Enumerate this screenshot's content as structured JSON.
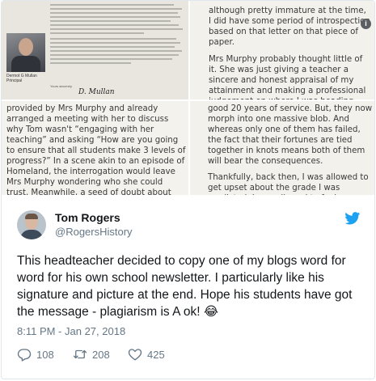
{
  "media": {
    "newsletter": {
      "caption_name": "Dermot G Mullan",
      "caption_role": "Principal",
      "sign_label": "Yours sincerely",
      "signature": "D. Mullan"
    },
    "blog_top_right": {
      "p1": "although pretty immature at the time, I did have some period of introspection based on that letter on that piece of paper.",
      "p2": "Mrs Murphy probably thought little of it. She was just giving a teacher a sincere and honest appraisal of my attainment and making a professional judgement on where I was heading. She probably sat in the staffroom afterwards and"
    },
    "blog_bottom_left": {
      "p1": "provided by Mrs Murphy and already arranged a meeting with her to discuss why Tom wasn't “engaging with her teaching” and asking “How are you going to ensure that all students make 3 levels of progress?” In a scene akin to an episode of Homeland, the interrogation would leave Mrs Murphy wondering who she could trust. Meanwhile, a seed of doubt about Mrs Murphy's competence would be planted in the"
    },
    "blog_bottom_right": {
      "p1": "good 20 years of service. But, they now morph into one massive blob. And whereas only one of them has failed, the fact that their fortunes are tied together in knots means both of them will bear the consequences.",
      "p2": "Thankfully, back then, I was allowed to get upset about the grade I was predicted. I was allowed to feel angry and frustrated. Thanks to"
    },
    "info_icon": "info-icon"
  },
  "tweet": {
    "author_name": "Tom Rogers",
    "author_handle": "@RogersHistory",
    "text": "This headteacher decided to copy one of my blogs word for word for his own school newsletter. I particularly like his signature and picture at the end. Hope his students have got the message - plagiarism is A ok! 😂",
    "time": "8:11 PM - Jan 27, 2018",
    "replies": "108",
    "retweets": "208",
    "likes": "425"
  },
  "colors": {
    "twitter_blue": "#1da1f2",
    "muted": "#657786",
    "text": "#14171a",
    "border": "#e1e8ed"
  }
}
